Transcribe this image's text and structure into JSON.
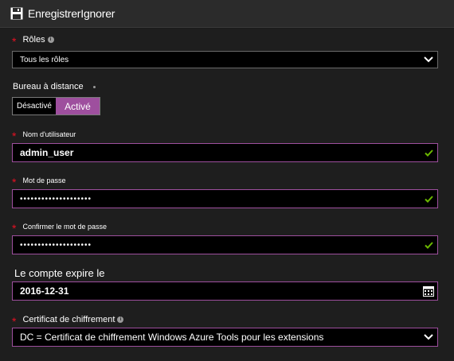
{
  "toolbar": {
    "save_label": "Enregistrer",
    "discard_label": "Ignorer",
    "save_icon": "floppy-disk-icon"
  },
  "form": {
    "roles": {
      "label": "Rôles",
      "value": "Tous les rôles",
      "required": true
    },
    "remote_desktop": {
      "label": "Bureau à distance",
      "off_label": "Désactivé",
      "on_label": "Activé",
      "selected": "Activé"
    },
    "username": {
      "label": "Nom d'utilisateur",
      "value": "admin_user",
      "required": true,
      "valid": true
    },
    "password": {
      "label": "Mot de passe",
      "value": "••••••••••••••••••••",
      "required": true,
      "valid": true
    },
    "confirm_password": {
      "label": "Confirmer le mot de passe",
      "value": "••••••••••••••••••••",
      "required": true,
      "valid": true
    },
    "expiry": {
      "label": "Le compte expire le",
      "value": "2016-12-31",
      "icon": "calendar-icon"
    },
    "certificate": {
      "label": "Certificat de chiffrement",
      "value": "DC = Certificat de chiffrement Windows Azure Tools pour les extensions",
      "required": true
    }
  },
  "colors": {
    "accent": "#9e4f9e",
    "required": "#e81123",
    "valid_check": "#6bb700",
    "background": "#1e1e1e",
    "toolbar": "#2b2b2b"
  }
}
